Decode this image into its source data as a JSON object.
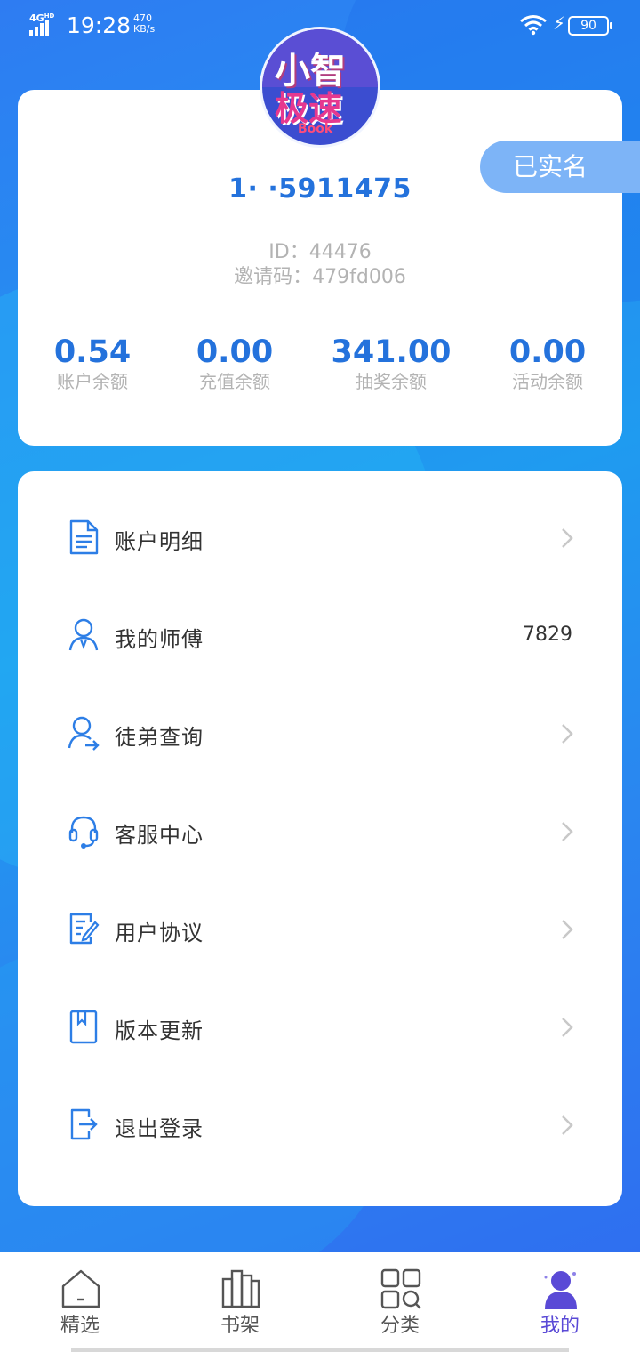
{
  "status_bar": {
    "network": "4G",
    "network_sup": "HD",
    "time": "19:28",
    "speed_value": "470",
    "speed_unit": "KB/s",
    "battery": "90"
  },
  "profile": {
    "avatar_text_top": "小智",
    "avatar_text_main": "极速",
    "avatar_text_book": "Book",
    "verified_label": "已实名",
    "phone": "1·  ·5911475",
    "id_line": "ID：44476",
    "invite_line": "邀请码：479fd006",
    "balances": [
      {
        "value": "0.54",
        "label": "账户余额"
      },
      {
        "value": "0.00",
        "label": "充值余额"
      },
      {
        "value": "341.00",
        "label": "抽奖余额"
      },
      {
        "value": "0.00",
        "label": "活动余额"
      }
    ]
  },
  "menu": [
    {
      "label": "账户明细",
      "icon": "document-icon",
      "value": ""
    },
    {
      "label": "我的师傅",
      "icon": "master-user-icon",
      "value": "7829"
    },
    {
      "label": "徒弟查询",
      "icon": "user-arrow-icon",
      "value": ""
    },
    {
      "label": "客服中心",
      "icon": "headset-icon",
      "value": ""
    },
    {
      "label": "用户协议",
      "icon": "agreement-edit-icon",
      "value": ""
    },
    {
      "label": "版本更新",
      "icon": "bookmark-icon",
      "value": ""
    },
    {
      "label": "退出登录",
      "icon": "logout-icon",
      "value": ""
    }
  ],
  "bottom_nav": [
    {
      "label": "精选",
      "icon": "home-icon",
      "active": false
    },
    {
      "label": "书架",
      "icon": "bookshelf-icon",
      "active": false
    },
    {
      "label": "分类",
      "icon": "category-grid-icon",
      "active": false
    },
    {
      "label": "我的",
      "icon": "profile-person-icon",
      "active": true
    }
  ],
  "colors": {
    "accent": "#2472dc",
    "nav_active": "#5a4ad6",
    "badge": "#7db4f7",
    "icon_blue": "#2d7ee6"
  }
}
